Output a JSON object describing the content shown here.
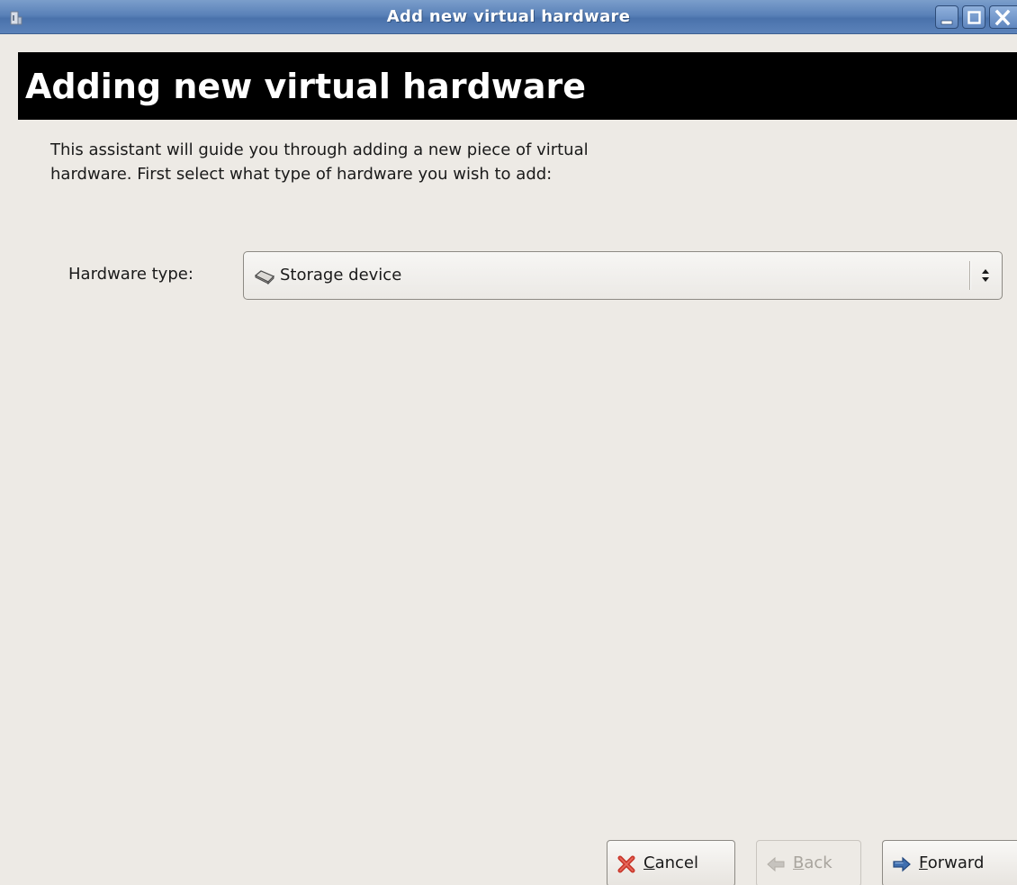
{
  "window": {
    "title": "Add new virtual hardware",
    "icons": {
      "app": "app-icon",
      "minimize": "minimize-icon",
      "maximize": "maximize-icon",
      "close": "close-icon"
    }
  },
  "header": {
    "title": "Adding new virtual hardware",
    "background_color": "#000000",
    "text_color": "#ffffff"
  },
  "intro": {
    "text": "This assistant will guide you through adding a new piece of virtual hardware. First select what type of hardware you wish to add:"
  },
  "hardware_type": {
    "label": "Hardware type:",
    "selected": "Storage device",
    "selected_icon": "storage-device-icon"
  },
  "buttons": {
    "cancel": {
      "mnemonic": "C",
      "rest": "ancel",
      "icon": "cancel-x-icon",
      "enabled": true
    },
    "back": {
      "mnemonic": "B",
      "rest": "ack",
      "icon": "back-arrow-icon",
      "enabled": false
    },
    "forward": {
      "mnemonic": "F",
      "rest": "orward",
      "icon": "forward-arrow-icon",
      "enabled": true
    }
  },
  "colors": {
    "titlebar": "#5a81b8",
    "window_bg": "#edeae5",
    "cancel_icon": "#c8362a",
    "forward_icon": "#3f6fb0"
  }
}
